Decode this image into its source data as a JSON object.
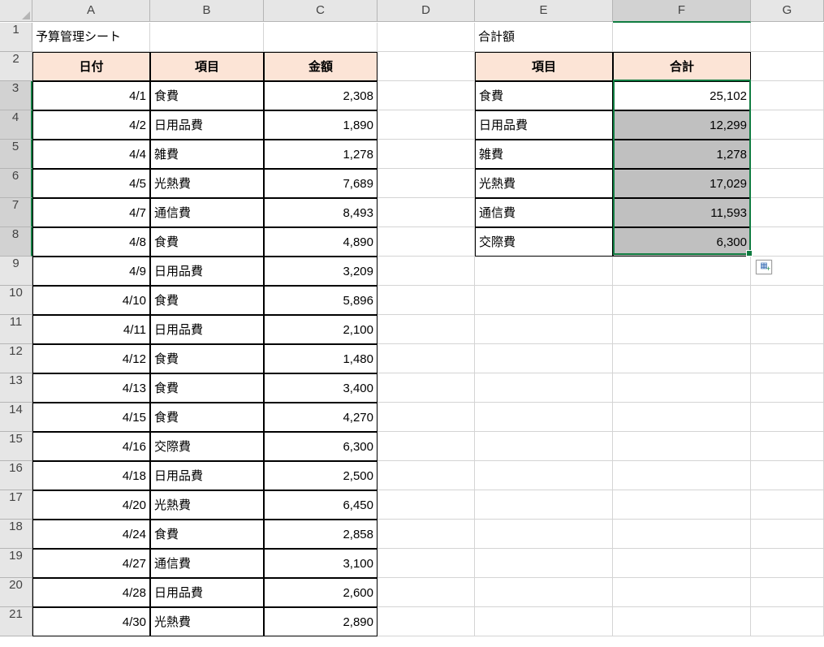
{
  "columns": [
    "A",
    "B",
    "C",
    "D",
    "E",
    "F",
    "G"
  ],
  "row_labels": [
    "1",
    "2",
    "3",
    "4",
    "5",
    "6",
    "7",
    "8",
    "9",
    "10",
    "11",
    "12",
    "13",
    "14",
    "15",
    "16",
    "17",
    "18",
    "19",
    "20",
    "21"
  ],
  "fixed": {
    "A1": "予算管理シート",
    "E1": "合計額",
    "A2": "日付",
    "B2": "項目",
    "C2": "金額",
    "E2": "項目",
    "F2": "合計"
  },
  "left_table": [
    {
      "date": "4/1",
      "item": "食費",
      "amount": "2,308"
    },
    {
      "date": "4/2",
      "item": "日用品費",
      "amount": "1,890"
    },
    {
      "date": "4/4",
      "item": "雑費",
      "amount": "1,278"
    },
    {
      "date": "4/5",
      "item": "光熱費",
      "amount": "7,689"
    },
    {
      "date": "4/7",
      "item": "通信費",
      "amount": "8,493"
    },
    {
      "date": "4/8",
      "item": "食費",
      "amount": "4,890"
    },
    {
      "date": "4/9",
      "item": "日用品費",
      "amount": "3,209"
    },
    {
      "date": "4/10",
      "item": "食費",
      "amount": "5,896"
    },
    {
      "date": "4/11",
      "item": "日用品費",
      "amount": "2,100"
    },
    {
      "date": "4/12",
      "item": "食費",
      "amount": "1,480"
    },
    {
      "date": "4/13",
      "item": "食費",
      "amount": "3,400"
    },
    {
      "date": "4/15",
      "item": "食費",
      "amount": "4,270"
    },
    {
      "date": "4/16",
      "item": "交際費",
      "amount": "6,300"
    },
    {
      "date": "4/18",
      "item": "日用品費",
      "amount": "2,500"
    },
    {
      "date": "4/20",
      "item": "光熱費",
      "amount": "6,450"
    },
    {
      "date": "4/24",
      "item": "食費",
      "amount": "2,858"
    },
    {
      "date": "4/27",
      "item": "通信費",
      "amount": "3,100"
    },
    {
      "date": "4/28",
      "item": "日用品費",
      "amount": "2,600"
    },
    {
      "date": "4/30",
      "item": "光熱費",
      "amount": "2,890"
    }
  ],
  "right_table": [
    {
      "item": "食費",
      "total": "25,102"
    },
    {
      "item": "日用品費",
      "total": "12,299"
    },
    {
      "item": "雑費",
      "total": "1,278"
    },
    {
      "item": "光熱費",
      "total": "17,029"
    },
    {
      "item": "通信費",
      "total": "11,593"
    },
    {
      "item": "交際費",
      "total": "6,300"
    }
  ],
  "chart_data": {
    "type": "table",
    "title": "予算管理シート",
    "left": {
      "columns": [
        "日付",
        "項目",
        "金額"
      ],
      "rows": [
        [
          "4/1",
          "食費",
          2308
        ],
        [
          "4/2",
          "日用品費",
          1890
        ],
        [
          "4/4",
          "雑費",
          1278
        ],
        [
          "4/5",
          "光熱費",
          7689
        ],
        [
          "4/7",
          "通信費",
          8493
        ],
        [
          "4/8",
          "食費",
          4890
        ],
        [
          "4/9",
          "日用品費",
          3209
        ],
        [
          "4/10",
          "食費",
          5896
        ],
        [
          "4/11",
          "日用品費",
          2100
        ],
        [
          "4/12",
          "食費",
          1480
        ],
        [
          "4/13",
          "食費",
          3400
        ],
        [
          "4/15",
          "食費",
          4270
        ],
        [
          "4/16",
          "交際費",
          6300
        ],
        [
          "4/18",
          "日用品費",
          2500
        ],
        [
          "4/20",
          "光熱費",
          6450
        ],
        [
          "4/24",
          "食費",
          2858
        ],
        [
          "4/27",
          "通信費",
          3100
        ],
        [
          "4/28",
          "日用品費",
          2600
        ],
        [
          "4/30",
          "光熱費",
          2890
        ]
      ]
    },
    "right": {
      "title": "合計額",
      "columns": [
        "項目",
        "合計"
      ],
      "rows": [
        [
          "食費",
          25102
        ],
        [
          "日用品費",
          12299
        ],
        [
          "雑費",
          1278
        ],
        [
          "光熱費",
          17029
        ],
        [
          "通信費",
          11593
        ],
        [
          "交際費",
          6300
        ]
      ]
    }
  }
}
